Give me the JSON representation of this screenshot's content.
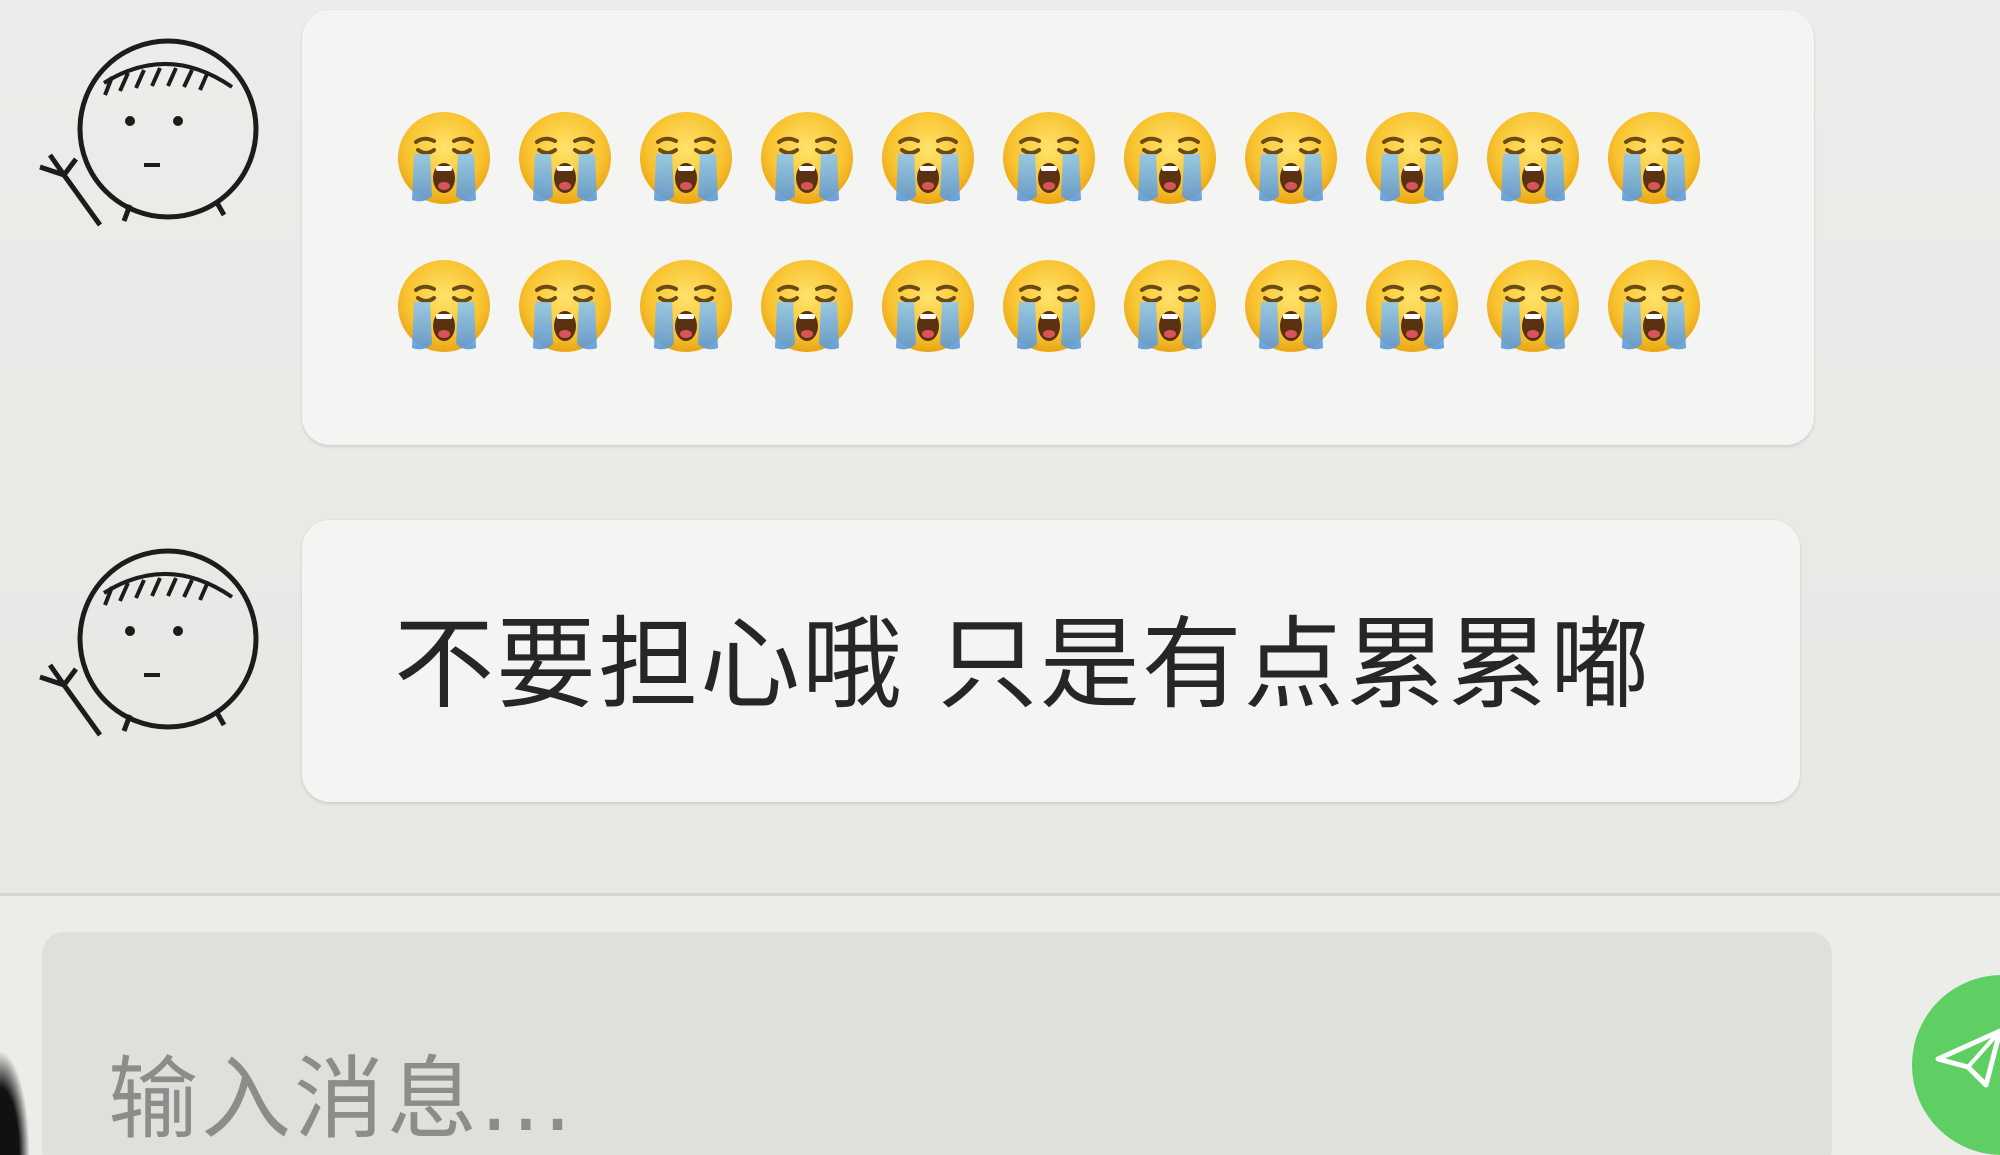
{
  "chat": {
    "messages": [
      {
        "type": "emoji",
        "emoji_name": "loudly-crying-face",
        "rows": 2,
        "per_row": 11,
        "count": 22
      },
      {
        "type": "text",
        "text": "不要担心哦 只是有点累累嘟"
      }
    ]
  },
  "composer": {
    "placeholder": "输入消息...",
    "send_icon": "paper-plane-icon"
  },
  "colors": {
    "background": "#e9e9e6",
    "bubble": "#f4f4f2",
    "input_box": "#dfdfdc",
    "send_button": "#5fcf63",
    "text": "#262626",
    "placeholder": "#8c8c8a"
  }
}
